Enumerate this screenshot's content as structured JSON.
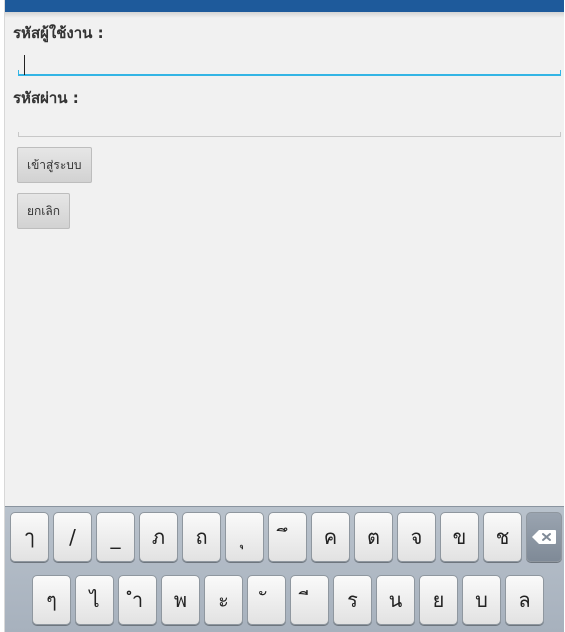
{
  "form": {
    "username_label": "รหัสผู้ใช้งาน :",
    "username_value": "",
    "password_label": "รหัสผ่าน :",
    "password_value": "",
    "login_button": "เข้าสู่ระบบ",
    "cancel_button": "ยกเลิก"
  },
  "keyboard": {
    "row1": [
      "ๅ",
      "/",
      "_",
      "ภ",
      "ถ",
      "ุ",
      "ึ",
      "ค",
      "ต",
      "จ",
      "ข",
      "ช"
    ],
    "row2": [
      "ๆ",
      "ไ",
      "ำ",
      "พ",
      "ะ",
      "ั",
      "ี",
      "ร",
      "น",
      "ย",
      "บ",
      "ล"
    ],
    "delete_icon": "backspace-icon"
  },
  "colors": {
    "focus_accent": "#33b5e5",
    "status_bar": "#1e5a9b"
  }
}
